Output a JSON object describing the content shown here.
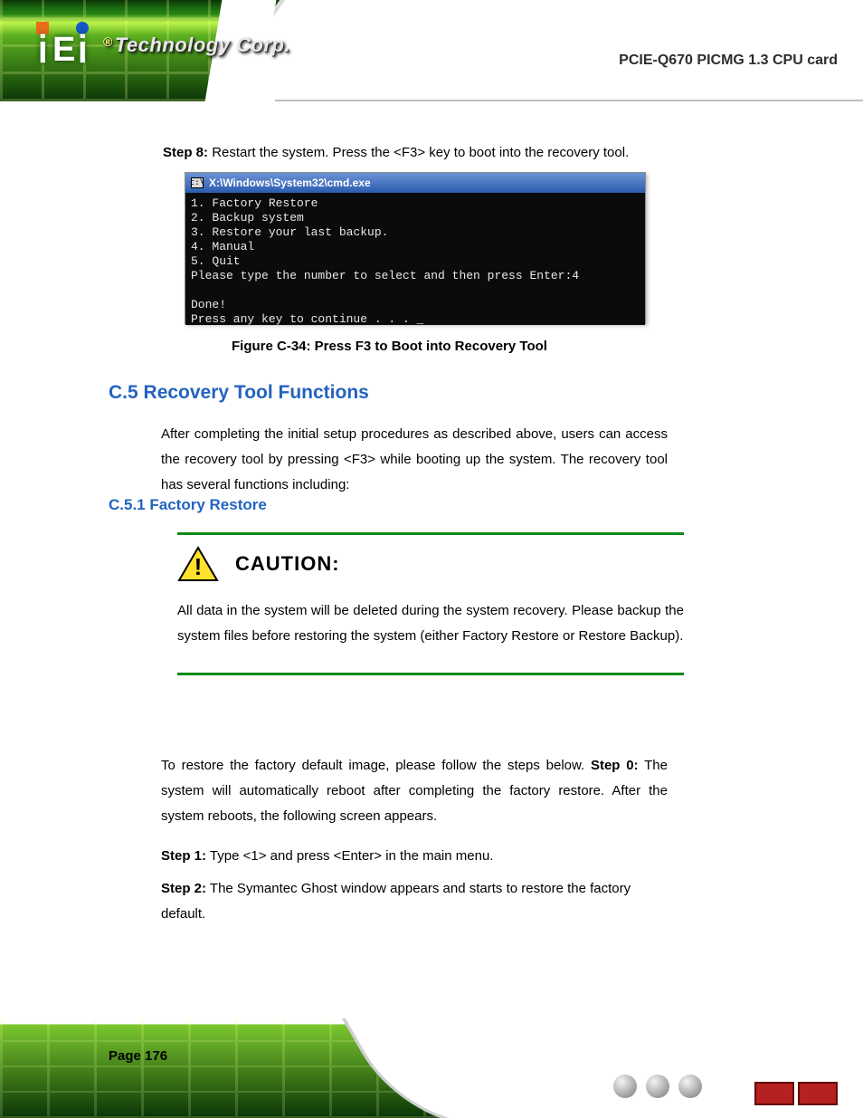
{
  "header": {
    "brand_prefix": "®",
    "brand": "Technology Corp.",
    "product": "PCIE-Q670 PICMG 1.3 CPU card"
  },
  "step8": {
    "label": "Step 8:",
    "text": "Restart the system. Press the <F3> key to boot into the recovery tool."
  },
  "cmd": {
    "title": "X:\\Windows\\System32\\cmd.exe",
    "lines": "1. Factory Restore\n2. Backup system\n3. Restore your last backup.\n4. Manual\n5. Quit\nPlease type the number to select and then press Enter:4\n\nDone!\nPress any key to continue . . . _"
  },
  "figure_caption": "Figure C-34: Press F3 to Boot into Recovery Tool",
  "section": {
    "num": "C.5",
    "title": "Recovery Tool Functions"
  },
  "intro": "After completing the initial setup procedures as described above, users can access the recovery tool by pressing <F3> while booting up the system. The recovery tool has several functions including:",
  "subsection": {
    "num": "C.5.1",
    "title": "Factory Restore"
  },
  "caution": {
    "label": "CAUTION:",
    "text": "All data in the system will be deleted during the system recovery. Please backup the system files before restoring the system (either Factory Restore or Restore Backup)."
  },
  "para2_pre": "To restore the factory default image, please follow the steps below.",
  "para2_bold": "Step 0:",
  "para2_post": " The system will automatically reboot after completing the factory restore. After the system reboots, the following screen appears.",
  "steps": [
    {
      "label": "Step 1:",
      "text": "Type <1> and press <Enter> in the main menu."
    },
    {
      "label": "Step 2:",
      "text": "The Symantec Ghost window appears and starts to restore the factory default."
    }
  ],
  "page_number": "Page 176"
}
